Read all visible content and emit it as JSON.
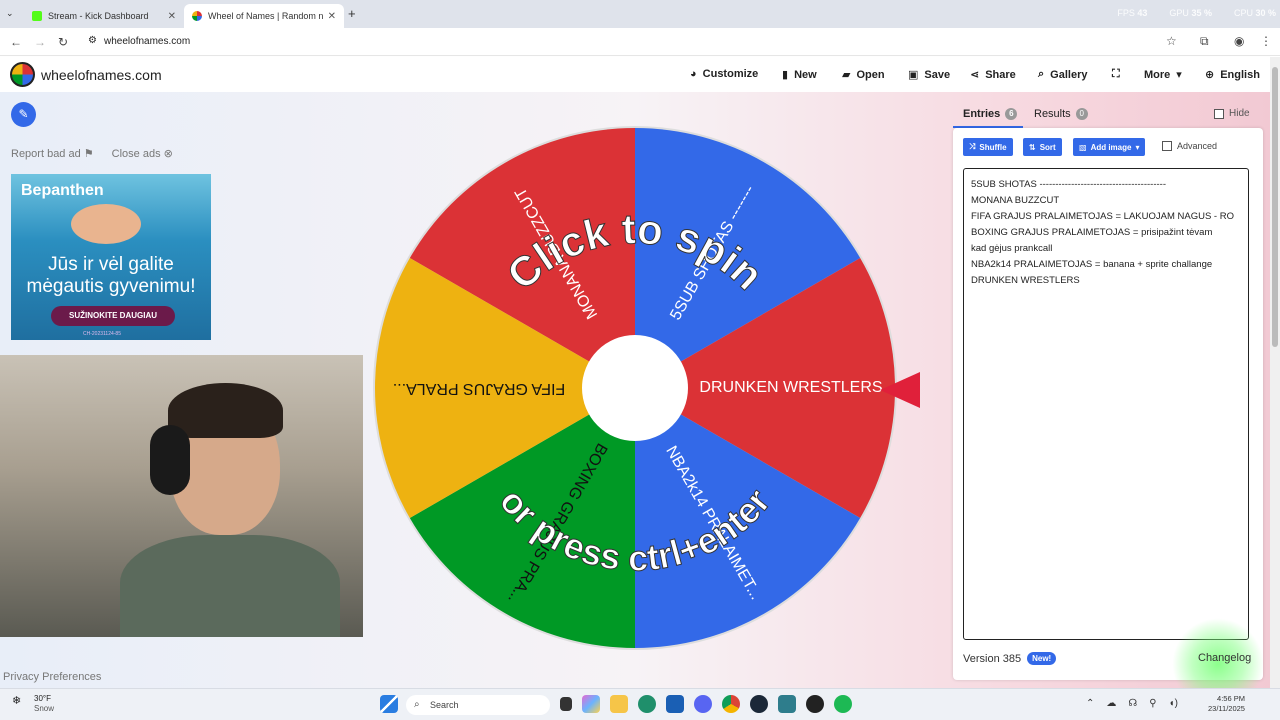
{
  "browser": {
    "tabs": [
      {
        "title": "Stream - Kick Dashboard",
        "icon": "kick-icon",
        "active": false
      },
      {
        "title": "Wheel of Names | Random nam",
        "icon": "wheel-icon",
        "active": true
      }
    ],
    "url": "wheelofnames.com",
    "overlay_stats": {
      "fps_label": "FPS",
      "fps": "43",
      "gpu_label": "GPU",
      "gpu": "35 %",
      "cpu_label": "CPU",
      "cpu": "30 %"
    }
  },
  "header": {
    "site_name": "wheelofnames.com",
    "menu": {
      "customize": "Customize",
      "new": "New",
      "open": "Open",
      "save": "Save",
      "share": "Share",
      "gallery": "Gallery",
      "more": "More",
      "language": "English"
    }
  },
  "ads": {
    "report_bad_ad": "Report bad ad",
    "close_ads": "Close ads",
    "banner": {
      "brand": "Bepanthen",
      "headline": "Jūs ir vėl galite mėgautis gyvenimu!",
      "cta": "SUŽINOKITE DAUGIAU",
      "code": "CH-20231124-85"
    }
  },
  "wheel": {
    "overlay_top": "Click to spin",
    "overlay_bottom": "or press ctrl+enter",
    "segments": [
      {
        "label": "MONANA BUZZCUT",
        "color": "#db3236"
      },
      {
        "label": "5SUB SHOTAS -------",
        "color": "#3369e8"
      },
      {
        "label": "DRUNKEN WRESTLERS",
        "color": "#db3236"
      },
      {
        "label": "NBA2k14 PRALAIMET...",
        "color": "#3369e8"
      },
      {
        "label": "BOXING GRAJUS PRA...",
        "color": "#009925"
      },
      {
        "label": "FIFA GRAJUS PRALA...",
        "color": "#eeb211"
      }
    ],
    "pointer_color": "#e0203a"
  },
  "panel": {
    "tab_entries": "Entries",
    "entries_count": "6",
    "tab_results": "Results",
    "results_count": "0",
    "hide_label": "Hide",
    "shuffle": "Shuffle",
    "sort": "Sort",
    "add_image": "Add image",
    "advanced": "Advanced",
    "entries": [
      "5SUB SHOTAS ----------------------------------------",
      "MONANA BUZZCUT",
      "FIFA GRAJUS PRALAIMETOJAS = LAKUOJAM NAGUS - RO",
      "BOXING GRAJUS PRALAIMETOJAS = prisipažint tėvam",
      "kad gėjus prankcall",
      "NBA2k14 PRALAIMETOJAS =  banana + sprite challange",
      "DRUNKEN WRESTLERS"
    ],
    "version": "Version 385",
    "new_badge": "New!",
    "changelog": "Changelog"
  },
  "footer": {
    "privacy": "Privacy Preferences"
  },
  "taskbar": {
    "weather_temp": "30°F",
    "weather_desc": "Snow",
    "search_placeholder": "Search",
    "time": "4:56 PM",
    "date": "23/11/2025"
  }
}
